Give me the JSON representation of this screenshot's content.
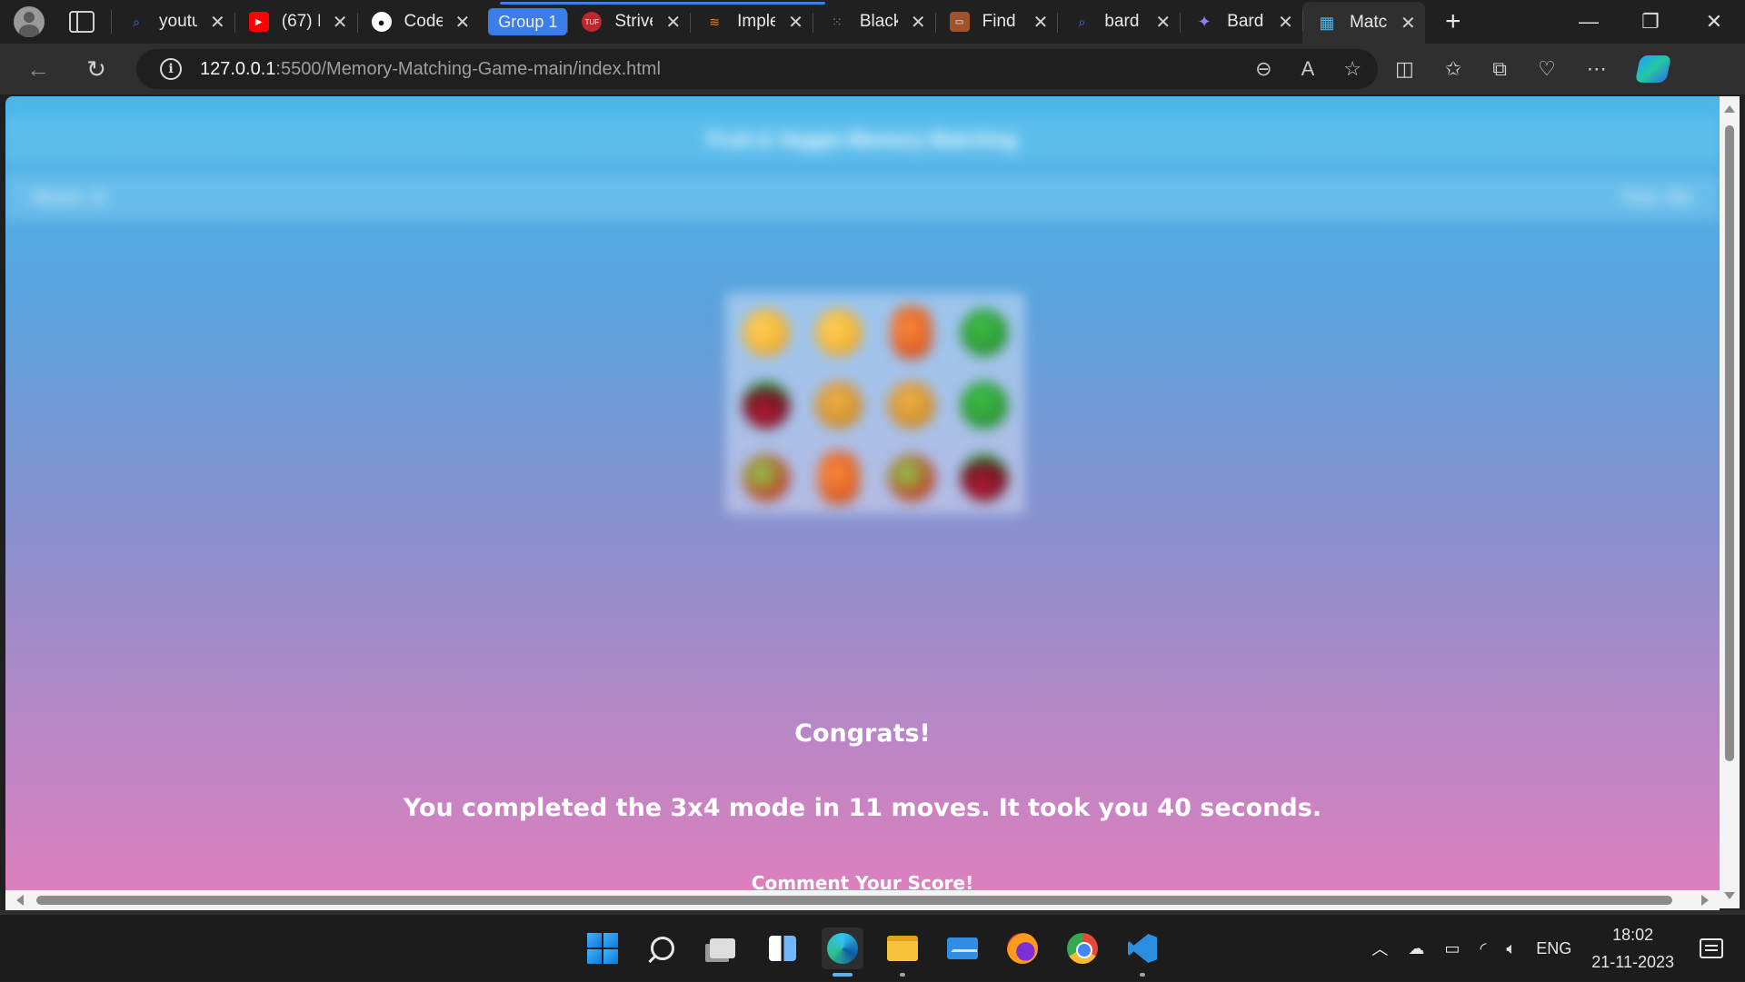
{
  "browser": {
    "tabs": [
      {
        "label": "youtu",
        "icon": "search-icon",
        "color": "#3b7de9"
      },
      {
        "label": "(67) I",
        "icon": "youtube-icon",
        "color": "#ff0000"
      },
      {
        "label": "Code",
        "icon": "github-icon",
        "color": "#ffffff"
      }
    ],
    "group_label": "Group 1",
    "group_tabs": [
      {
        "label": "Strive",
        "icon": "tuf-icon",
        "color": "#c0262d"
      },
      {
        "label": "Imple",
        "icon": "stackoverflow-icon",
        "color": "#f48024"
      },
      {
        "label": "Black",
        "icon": "dots-icon",
        "color": "#888888"
      },
      {
        "label": "Find",
        "icon": "image-icon",
        "color": "#a0522d"
      },
      {
        "label": "bard",
        "icon": "search-icon",
        "color": "#3b7de9"
      },
      {
        "label": "Bard",
        "icon": "bard-sparkle-icon",
        "color": "#8e7cf0"
      },
      {
        "label": "Matc",
        "icon": "grid-icon",
        "color": "#4ab7ea",
        "active": true
      }
    ],
    "url_host": "127.0.0.1",
    "url_path": ":5500/Memory-Matching-Game-main/index.html"
  },
  "page": {
    "title": "Fruit & Veggie Memory Matching",
    "bar_left": "Moves: 11",
    "bar_right": "Time: 40s",
    "board": [
      [
        "orange-yellow",
        "orange-yellow",
        "carrot",
        "broccoli"
      ],
      [
        "beet",
        "bread",
        "bread",
        "broccoli"
      ],
      [
        "pepper",
        "carrot",
        "pepper",
        "beet"
      ]
    ],
    "congrats": "Congrats!",
    "summary": "You completed the 3x4 mode in 11 moves. It took you 40 seconds.",
    "comment": "Comment Your Score!"
  },
  "taskbar": {
    "apps": [
      "start-icon",
      "search-icon",
      "task-view-icon",
      "widgets-icon",
      "edge-icon",
      "file-explorer-icon",
      "mail-icon",
      "firefox-icon",
      "chrome-icon",
      "vscode-icon"
    ],
    "language": "ENG",
    "time": "18:02",
    "date": "21-11-2023"
  },
  "colors": {
    "accent": "#3b7de9",
    "page_gradient_top": "#4ab7ea",
    "page_gradient_bottom": "#e07fbc"
  }
}
